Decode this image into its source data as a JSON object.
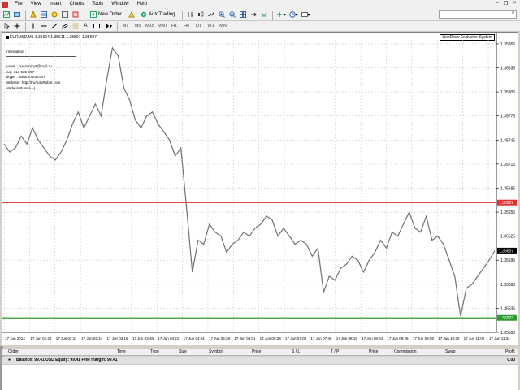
{
  "menu": {
    "items": [
      "File",
      "View",
      "Insert",
      "Charts",
      "Tools",
      "Window",
      "Help"
    ]
  },
  "toolbar": {
    "new_order_label": "New Order",
    "autotrading_label": "AutoTrading",
    "timeframes": [
      "M1",
      "M5",
      "M15",
      "M30",
      "H1",
      "H4",
      "D1",
      "W1",
      "MN"
    ]
  },
  "chart": {
    "title": "EURUSD,M1  1.35604 1.35611 1.35597 1.35607",
    "ea_label": "LineDraw Exclusive System",
    "info": {
      "heading": "Information :",
      "email": "e-mail : fxautorobot@mail.ru",
      "icq": "icq : 413-535-697",
      "skype": "skype : fxautorobot.com",
      "website": "Website : http://FxAutoRobot.com",
      "made_in": "Made in Russia =)"
    },
    "colors": {
      "resistance_line": "#e03030",
      "support_line": "#2e9a2e",
      "price_line": "#707070",
      "grid": "#c8c8c8"
    }
  },
  "chart_data": {
    "type": "line",
    "title": "EURUSD,M1  1.35604 1.35611 1.35597 1.35607",
    "ylim": [
      1.35505,
      1.3587
    ],
    "y_ticks": [
      "1.35865",
      "1.35835",
      "1.35805",
      "1.35775",
      "1.35745",
      "1.35715",
      "1.35685",
      "1.35655",
      "1.35625",
      "1.35595",
      "1.35565",
      "1.35535",
      "1.35505"
    ],
    "x_ticks": [
      "17 Jun 2014",
      "17 Jun 01:28",
      "17 Jun 02:11",
      "17 Jun 02:44",
      "17 Jun 03:16",
      "17 Jun 03:48",
      "17 Jun 04:21",
      "17 Jun 04:54",
      "17 Jun 05:28",
      "17 Jun 06:01",
      "17 Jun 06:33",
      "17 Jun 07:08",
      "17 Jun 07:46",
      "17 Jun 08:19",
      "17 Jun 08:54",
      "17 Jun 09:26",
      "17 Jun 09:58",
      "17 Jun 10:30",
      "17 Jun 11:02",
      "17 Jun 11:34"
    ],
    "hlines": [
      {
        "name": "resistance",
        "value": 1.35667,
        "label": "1.35667"
      },
      {
        "name": "support",
        "value": 1.35523,
        "label": "1.35523"
      }
    ],
    "current_price": {
      "value": 1.35607,
      "label": "1.35607"
    },
    "series": [
      {
        "values": [
          1.3574,
          1.3573,
          1.35735,
          1.3575,
          1.3574,
          1.3576,
          1.35745,
          1.35735,
          1.35725,
          1.3572,
          1.3573,
          1.35745,
          1.35765,
          1.3578,
          1.3576,
          1.35775,
          1.3579,
          1.35775,
          1.3582,
          1.3586,
          1.3585,
          1.3581,
          1.35795,
          1.3577,
          1.3576,
          1.35775,
          1.3578,
          1.35765,
          1.35755,
          1.35745,
          1.35725,
          1.35735,
          1.3566,
          1.3558,
          1.3562,
          1.35615,
          1.3564,
          1.3563,
          1.35625,
          1.35605,
          1.35615,
          1.3562,
          1.3563,
          1.35625,
          1.35635,
          1.3564,
          1.3565,
          1.35645,
          1.35625,
          1.35635,
          1.35625,
          1.35615,
          1.3562,
          1.35615,
          1.356,
          1.3561,
          1.35555,
          1.35575,
          1.3557,
          1.35585,
          1.3559,
          1.356,
          1.35595,
          1.3558,
          1.35595,
          1.35605,
          1.3562,
          1.3561,
          1.3563,
          1.35625,
          1.3564,
          1.35655,
          1.35635,
          1.3563,
          1.3565,
          1.3562,
          1.35625,
          1.35615,
          1.35595,
          1.35575,
          1.35525,
          1.3556,
          1.35565,
          1.35575,
          1.35585,
          1.35595,
          1.35607
        ]
      }
    ]
  },
  "terminal": {
    "columns": [
      "Order",
      "Time",
      "Type",
      "Size",
      "Symbol",
      "Price",
      "S / L",
      "T / P",
      "Price",
      "Commission",
      "Swap",
      "Profit"
    ],
    "balance_text": "Balance: 99.41 USD  Equity: 99.41  Free margin: 99.41",
    "profit_value": "0.00"
  }
}
